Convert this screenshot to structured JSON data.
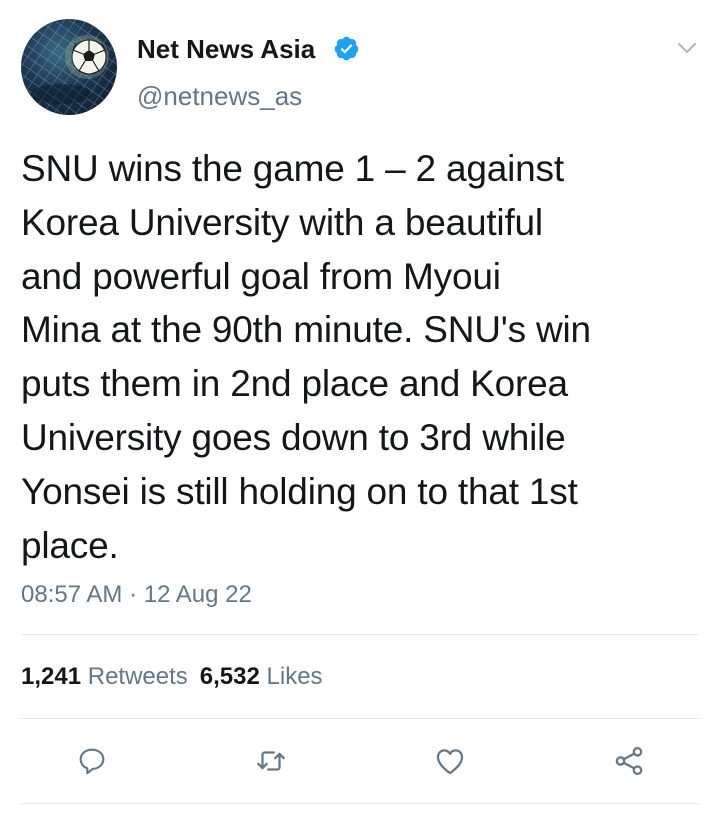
{
  "tweet": {
    "display_name": "Net News Asia",
    "handle": "@netnews_as",
    "text": "SNU wins the game 1 – 2 against\nKorea University with a beautiful\nand powerful goal from Myoui\nMina at the 90th minute. SNU's win\nputs them in 2nd place and Korea\nUniversity goes down to 3rd while\nYonsei is still holding on to that 1st\nplace.",
    "time": "08:57 AM",
    "separator": "·",
    "date": "12 Aug 22",
    "retweets_count": "1,241",
    "retweets_label": "Retweets",
    "likes_count": "6,532",
    "likes_label": "Likes"
  },
  "icons": {
    "verified": "verified-badge-icon",
    "menu": "chevron-down-icon",
    "reply": "reply-icon",
    "retweet": "retweet-icon",
    "like": "heart-icon",
    "share": "share-icon"
  },
  "colors": {
    "text_primary": "#14171a",
    "text_secondary": "#657786",
    "verified_blue": "#1da1f2",
    "icon_gray": "#657786",
    "divider": "#e1e8ed"
  }
}
